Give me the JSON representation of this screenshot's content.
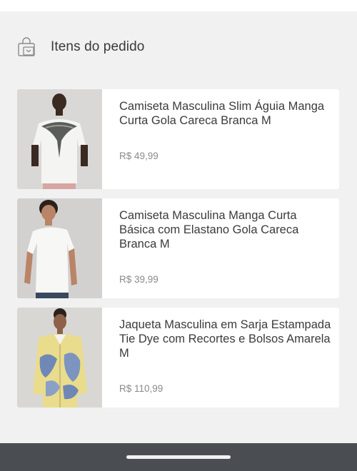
{
  "header": {
    "title": "Itens do pedido",
    "icon": "shopping-bag-icon"
  },
  "items": [
    {
      "name": "Camiseta Masculina Slim Águia Manga Curta Gola Careca Branca M",
      "price": "R$  49,99",
      "image": "white-tshirt-eagle-print-photo"
    },
    {
      "name": "Camiseta Masculina Manga Curta Básica  com Elastano Gola Careca Branca M",
      "price": "R$  39,99",
      "image": "white-basic-tshirt-photo"
    },
    {
      "name": "Jaqueta Masculina em Sarja Estampada Tie Dye com Recortes e Bolsos Amarela M",
      "price": "R$  110,99",
      "image": "tie-dye-denim-jacket-photo"
    }
  ],
  "colors": {
    "background": "#f1f1f1",
    "card": "#ffffff",
    "nav_bar": "#4a4e52"
  }
}
